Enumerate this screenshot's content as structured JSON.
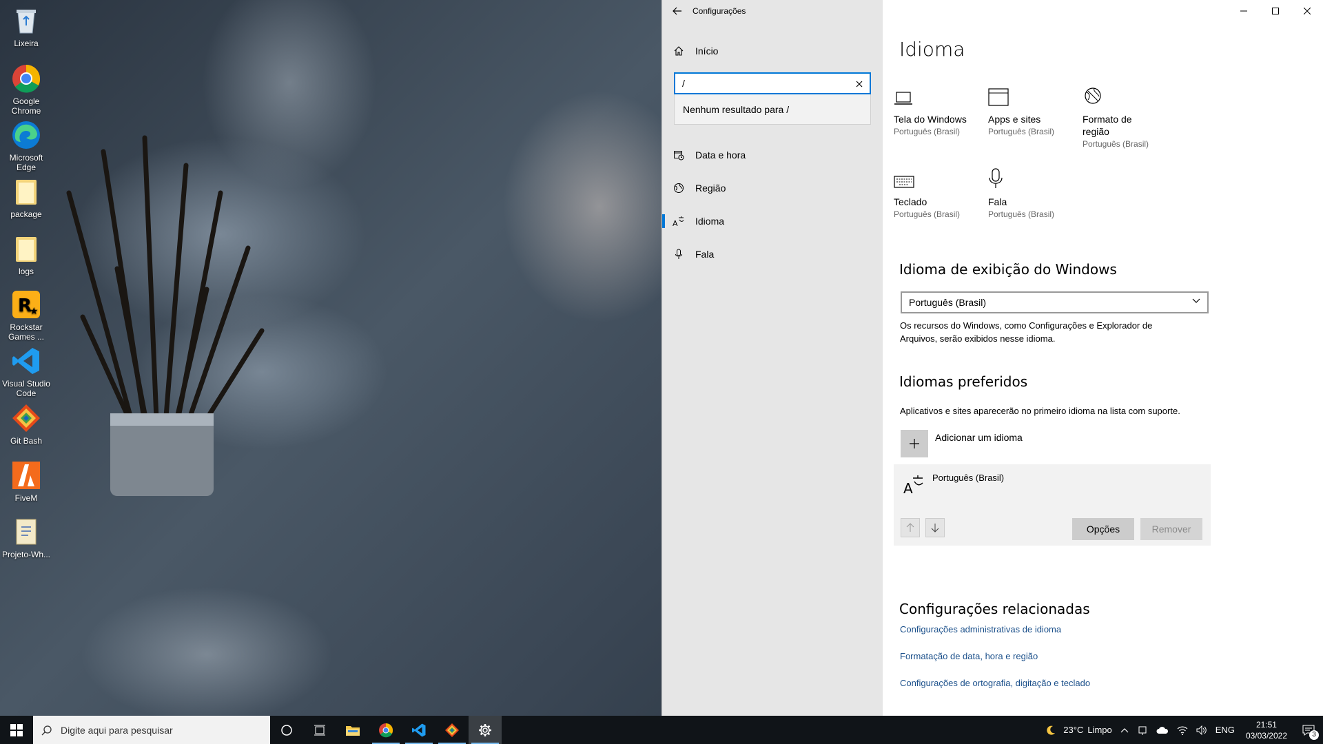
{
  "desktop": {
    "icons": [
      {
        "label": "Lixeira",
        "icon": "recycle-bin-icon"
      },
      {
        "label": "Google Chrome",
        "icon": "chrome-icon"
      },
      {
        "label": "Microsoft Edge",
        "icon": "edge-icon"
      },
      {
        "label": "package",
        "icon": "folder-icon"
      },
      {
        "label": "logs",
        "icon": "folder-icon"
      },
      {
        "label": "Rockstar Games ...",
        "icon": "rockstar-icon"
      },
      {
        "label": "Visual Studio Code",
        "icon": "vscode-icon"
      },
      {
        "label": "Git Bash",
        "icon": "git-icon"
      },
      {
        "label": "FiveM",
        "icon": "fivem-icon"
      },
      {
        "label": "Projeto-Wh...",
        "icon": "file-icon"
      }
    ]
  },
  "window": {
    "title": "Configurações"
  },
  "sidebar": {
    "home_label": "Início",
    "search": {
      "value": "/",
      "placeholder": ""
    },
    "search_result": "Nenhum resultado para /",
    "items": [
      {
        "label": "Data e hora",
        "icon": "clock-calendar-icon"
      },
      {
        "label": "Região",
        "icon": "globe-icon"
      },
      {
        "label": "Idioma",
        "icon": "language-icon",
        "active": true
      },
      {
        "label": "Fala",
        "icon": "microphone-icon"
      }
    ]
  },
  "main": {
    "title": "Idioma",
    "tiles": [
      {
        "name": "Tela do Windows",
        "sub": "Português (Brasil)",
        "icon": "laptop-icon"
      },
      {
        "name": "Apps e sites",
        "sub": "Português (Brasil)",
        "icon": "browser-window-icon"
      },
      {
        "name": "Formato de região",
        "sub": "Português (Brasil)",
        "icon": "region-format-icon"
      },
      {
        "name": "Teclado",
        "sub": "Português (Brasil)",
        "icon": "keyboard-icon"
      },
      {
        "name": "Fala",
        "sub": "Português (Brasil)",
        "icon": "microphone-icon"
      }
    ],
    "display_language": {
      "heading": "Idioma de exibição do Windows",
      "selected": "Português (Brasil)",
      "description": "Os recursos do Windows, como Configurações e Explorador de Arquivos, serão exibidos nesse idioma."
    },
    "preferred": {
      "heading": "Idiomas preferidos",
      "description": "Aplicativos e sites aparecerão no primeiro idioma na lista com suporte.",
      "add_label": "Adicionar um idioma",
      "language": "Português (Brasil)",
      "options_label": "Opções",
      "remove_label": "Remover"
    },
    "related": {
      "heading": "Configurações relacionadas",
      "links": [
        "Configurações administrativas de idioma",
        "Formatação de data, hora e região",
        "Configurações de ortografia, digitação e teclado"
      ]
    }
  },
  "taskbar": {
    "search_placeholder": "Digite aqui para pesquisar",
    "apps": [
      "cortana-icon",
      "task-view-icon",
      "file-explorer-icon",
      "chrome-icon",
      "vscode-icon",
      "git-icon",
      "settings-gear-icon"
    ],
    "weather": {
      "temp": "23°C",
      "condition": "Limpo"
    },
    "lang": "ENG",
    "time": "21:51",
    "date": "03/03/2022",
    "notifications": "3"
  },
  "colors": {
    "accent": "#0078d7",
    "sidebar_bg": "#e6e6e6",
    "taskbar_bg": "#101418",
    "link": "#1a4f8a"
  }
}
